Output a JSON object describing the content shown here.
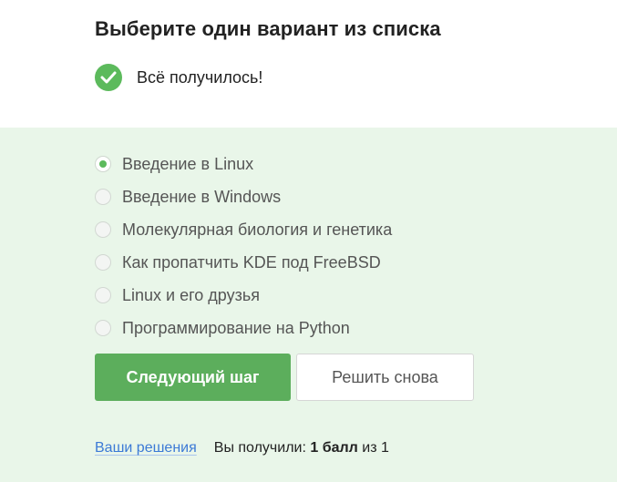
{
  "title": "Выберите один вариант из списка",
  "status": {
    "icon": "check-circle-icon",
    "text": "Всё получилось!",
    "color": "#5cba5c"
  },
  "options": [
    {
      "label": "Введение в Linux",
      "selected": true
    },
    {
      "label": "Введение в Windows",
      "selected": false
    },
    {
      "label": "Молекулярная биология и генетика",
      "selected": false
    },
    {
      "label": "Как пропатчить KDE под FreeBSD",
      "selected": false
    },
    {
      "label": "Linux и его друзья",
      "selected": false
    },
    {
      "label": "Программирование на Python",
      "selected": false
    }
  ],
  "buttons": {
    "next_label": "Следующий шаг",
    "retry_label": "Решить снова"
  },
  "footer": {
    "solutions_link": "Ваши решения",
    "score_prefix": "Вы получили:",
    "score_value": "1 балл",
    "score_of": "из 1"
  },
  "colors": {
    "accent": "#5cae5c",
    "panel_bg": "#e9f6e9",
    "link": "#3c7ad6"
  }
}
